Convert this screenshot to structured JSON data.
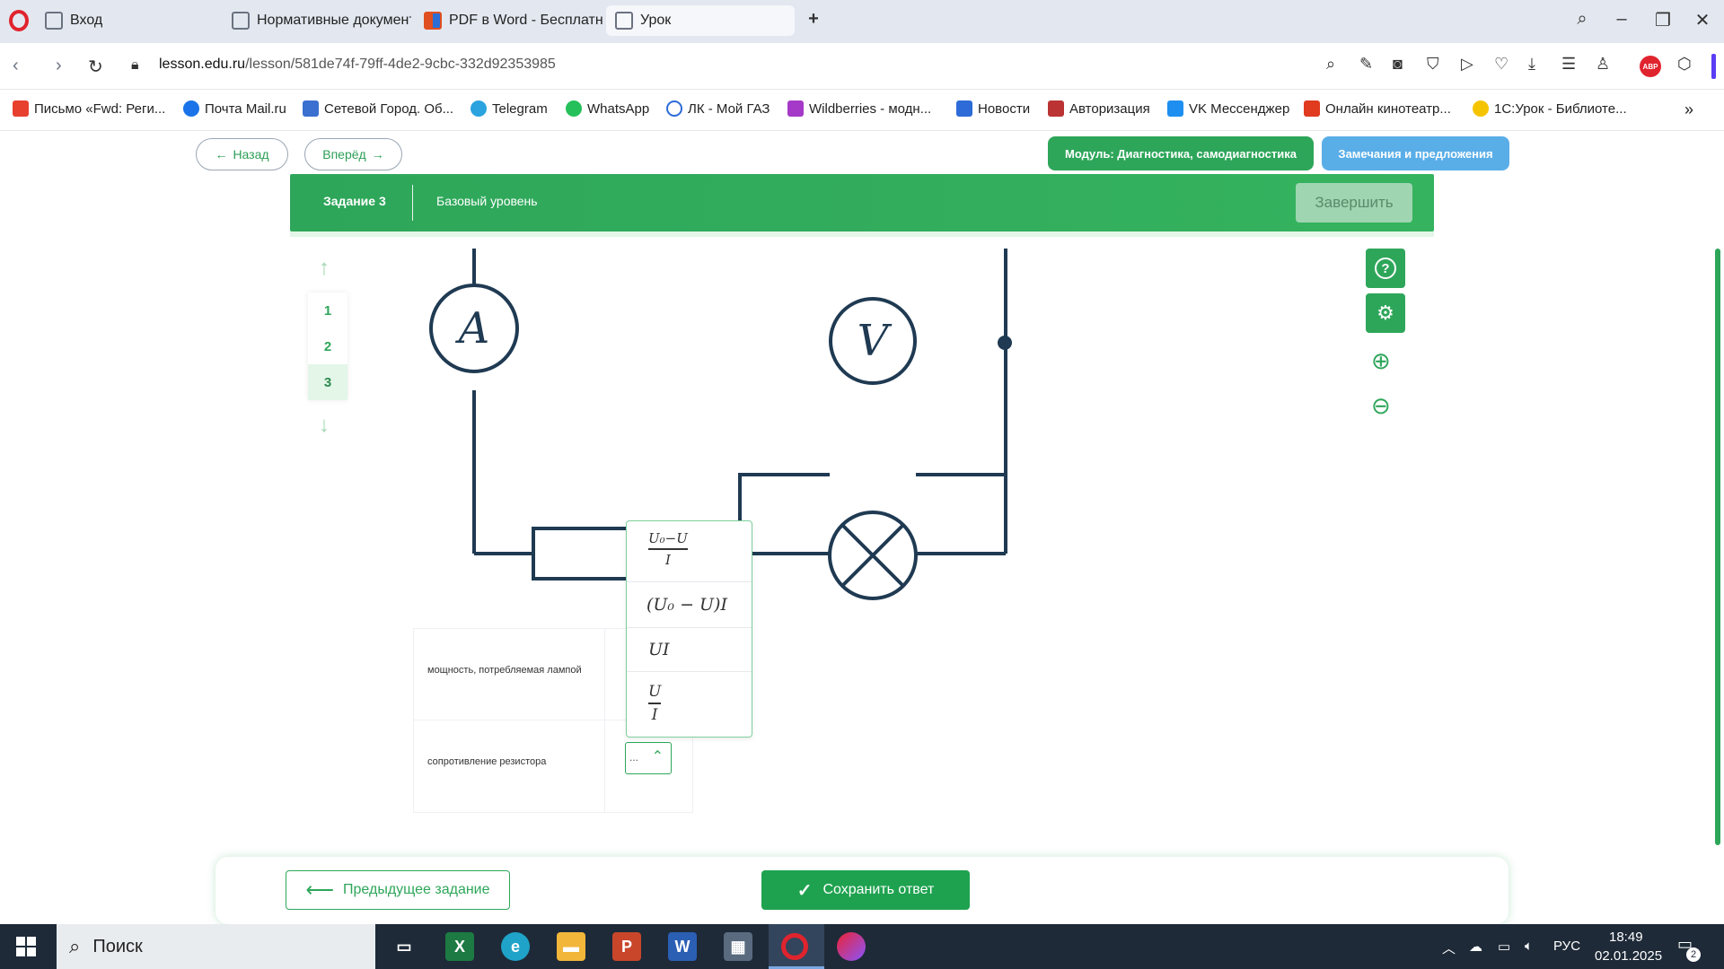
{
  "browser": {
    "tabs": [
      {
        "title": "Вход"
      },
      {
        "title": "Нормативные документы"
      },
      {
        "title": "PDF в Word - Бесплатный"
      },
      {
        "title": "Урок"
      }
    ],
    "url_domain": "lesson.edu.ru",
    "url_path": "/lesson/581de74f-79ff-4de2-9cbc-332d92353985",
    "bookmarks": [
      {
        "label": "Письмо «Fwd: Реги..."
      },
      {
        "label": "Почта Mail.ru"
      },
      {
        "label": "Сетевой Город. Об..."
      },
      {
        "label": "Telegram"
      },
      {
        "label": "WhatsApp"
      },
      {
        "label": "ЛК - Мой ГАЗ"
      },
      {
        "label": "Wildberries - модн..."
      },
      {
        "label": "Новости"
      },
      {
        "label": "Авторизация"
      },
      {
        "label": "VK Мессенджер"
      },
      {
        "label": "Онлайн кинотеатр..."
      },
      {
        "label": "1С:Урок - Библиоте..."
      }
    ],
    "abp_label": "ABP"
  },
  "lesson": {
    "back_label": "Назад",
    "forward_label": "Вперёд",
    "module_label": "Модуль: Диагностика, самодиагностика",
    "feedback_label": "Замечания и предложения",
    "task_title": "Задание 3",
    "task_level": "Базовый уровень",
    "finish_label": "Завершить",
    "question_numbers": [
      "1",
      "2",
      "3"
    ],
    "circuit": {
      "ammeter": "A",
      "voltmeter": "V"
    },
    "table": [
      {
        "label": "мощность, потребляемая лампой"
      },
      {
        "label": "сопротивление резистора",
        "value": "..."
      }
    ],
    "dropdown_options": {
      "opt1_num": "U₀−U",
      "opt1_den": "I",
      "opt2": "(U₀ − U)I",
      "opt3": "UI",
      "opt4_num": "U",
      "opt4_den": "I"
    },
    "prev_task_label": "Предыдущее задание",
    "save_label": "Сохранить ответ"
  },
  "taskbar": {
    "search_label": "Поиск",
    "language": "РУС",
    "time": "18:49",
    "date": "02.01.2025",
    "notifications": "2"
  }
}
